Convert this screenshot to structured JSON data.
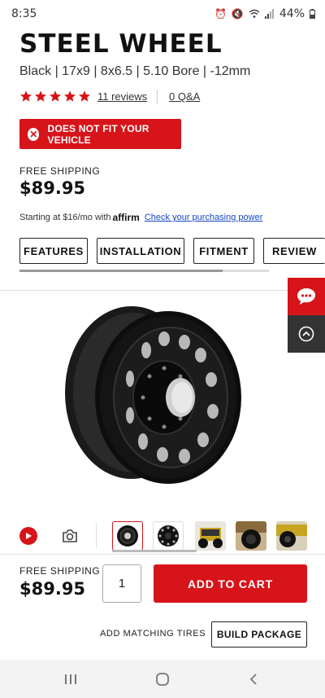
{
  "status_bar": {
    "time": "8:35",
    "battery": "44%",
    "icons": [
      "alarm-icon",
      "mute-icon",
      "wifi-icon",
      "signal-icon",
      "battery-icon"
    ]
  },
  "product": {
    "title": "STEEL WHEEL",
    "subtitle": "Black | 17x9 | 8x6.5 | 5.10 Bore | -12mm",
    "rating_stars": 5,
    "reviews_link": "11 reviews",
    "qa_link": "0 Q&A"
  },
  "fit_banner": {
    "text": "DOES NOT FIT YOUR VEHICLE",
    "color": "#d7141a"
  },
  "pricing": {
    "shipping": "FREE SHIPPING",
    "price": "$89.95",
    "financing_prefix": "Starting at $16/mo with",
    "financing_brand": "affirm",
    "financing_link": "Check your purchasing power"
  },
  "tabs": [
    "FEATURES",
    "INSTALLATION",
    "FITMENT",
    "REVIEW"
  ],
  "media": {
    "thumbnails": [
      "wheel-angle-thumbnail",
      "wheel-front-thumbnail",
      "jeep-rear-thumbnail",
      "wheel-on-vehicle-thumbnail",
      "jeep-side-thumbnail"
    ],
    "selected_index": 0
  },
  "purchase": {
    "shipping": "FREE SHIPPING",
    "price": "$89.95",
    "quantity": "1",
    "add_to_cart": "ADD TO CART",
    "matching_tires": "ADD MATCHING TIRES",
    "build_package": "BUILD PACKAGE"
  },
  "colors": {
    "accent": "#d7141a",
    "link": "#1846c6",
    "dark_button": "#333333"
  }
}
